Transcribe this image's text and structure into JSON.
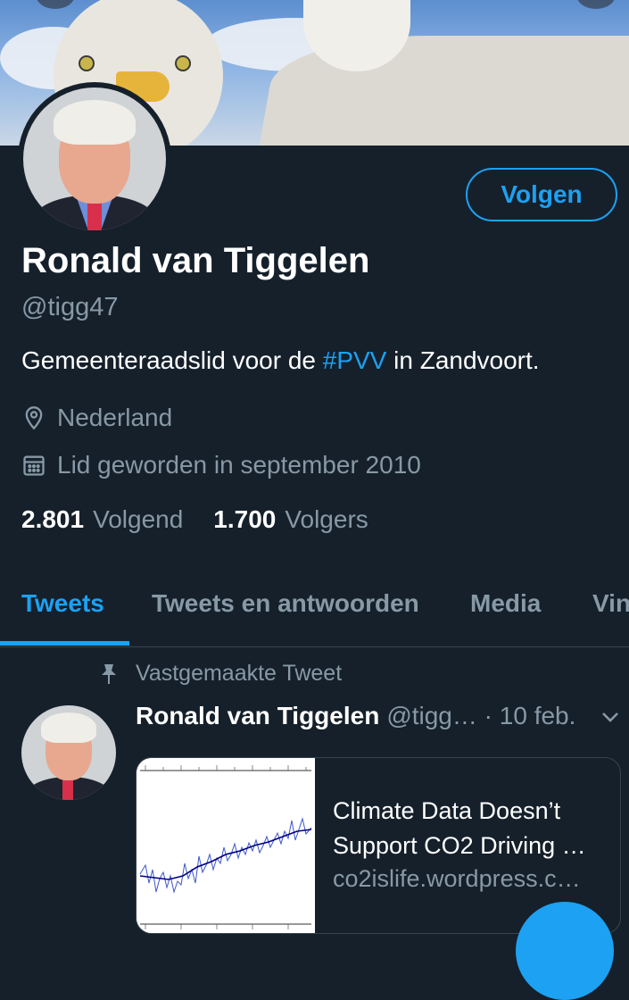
{
  "profile": {
    "name": "Ronald van Tiggelen",
    "handle": "@tigg47",
    "follow_label": "Volgen",
    "bio_before": "Gemeenteraadslid voor de ",
    "bio_hashtag": "#PVV",
    "bio_after": " in Zandvoort.",
    "location": "Nederland",
    "joined": "Lid geworden in september 2010",
    "following_count": "2.801",
    "following_label": "Volgend",
    "followers_count": "1.700",
    "followers_label": "Volgers"
  },
  "tabs": [
    {
      "label": "Tweets",
      "active": true
    },
    {
      "label": "Tweets en antwoorden",
      "active": false
    },
    {
      "label": "Media",
      "active": false
    },
    {
      "label": "Vin",
      "active": false
    }
  ],
  "pinned": {
    "label": "Vastgemaakte Tweet",
    "author": "Ronald van Tiggelen",
    "handle": "@tigg…",
    "date": "· 10 feb.",
    "card_title": "Climate Data Doesn’t Support CO2 Driving …",
    "card_domain": "co2islife.wordpress.c…"
  },
  "colors": {
    "background": "#15202b",
    "accent": "#1da1f2",
    "muted": "#8899a6"
  },
  "icons": {
    "location": "location-pin-icon",
    "calendar": "calendar-icon",
    "pin": "pin-icon",
    "caret": "chevron-down-icon"
  }
}
